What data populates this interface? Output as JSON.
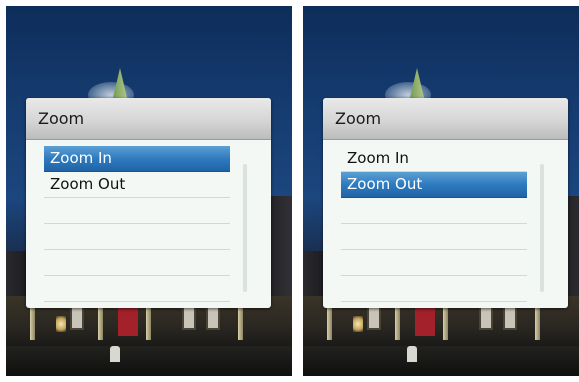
{
  "screens": [
    {
      "dialog": {
        "title": "Zoom",
        "items": [
          {
            "label": "Zoom In",
            "selected": true
          },
          {
            "label": "Zoom Out",
            "selected": false
          },
          {
            "label": "",
            "selected": false
          },
          {
            "label": "",
            "selected": false
          },
          {
            "label": "",
            "selected": false
          },
          {
            "label": "",
            "selected": false
          }
        ]
      }
    },
    {
      "dialog": {
        "title": "Zoom",
        "items": [
          {
            "label": "Zoom In",
            "selected": false
          },
          {
            "label": "Zoom Out",
            "selected": true
          },
          {
            "label": "",
            "selected": false
          },
          {
            "label": "",
            "selected": false
          },
          {
            "label": "",
            "selected": false
          },
          {
            "label": "",
            "selected": false
          }
        ]
      }
    }
  ],
  "colors": {
    "selection": "#2f7bbf",
    "dialog_background": "#f4f8f5",
    "header_background": "#d6d6d6",
    "door": "#a2212a"
  }
}
